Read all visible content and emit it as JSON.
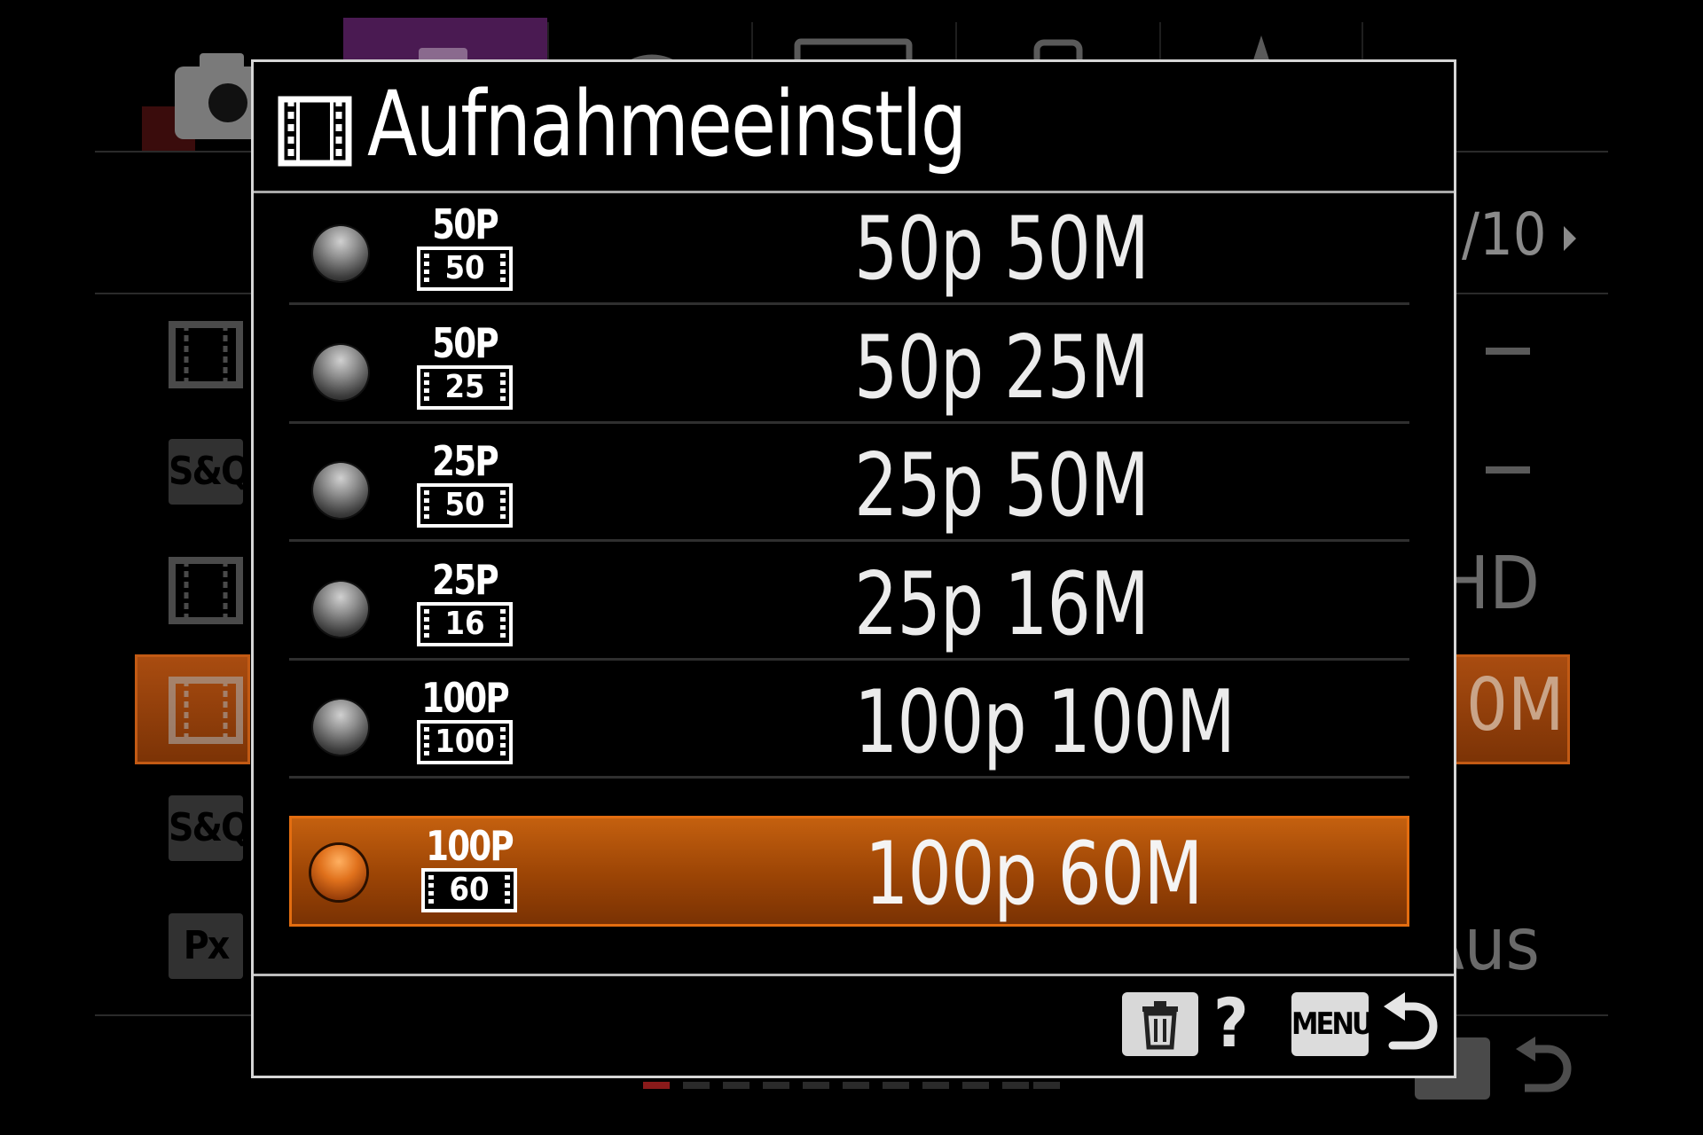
{
  "background": {
    "tabs": [
      {
        "name": "camera-tab",
        "active": false
      },
      {
        "name": "camera2-tab",
        "active": true
      },
      {
        "name": "network-tab",
        "active": false
      },
      {
        "name": "playback-tab",
        "active": false
      },
      {
        "name": "setup-tab",
        "active": false
      },
      {
        "name": "mymenu-tab",
        "active": false
      }
    ],
    "page_indicator": "/10",
    "side_chips": [
      "S&Q",
      "S&Q",
      "Px"
    ],
    "right_values": [
      "HD",
      "0M",
      "Aus"
    ],
    "menu_label": "MENU"
  },
  "dialog": {
    "title": "Aufnahmeeinstlg",
    "title_icon": "movie-icon",
    "options": [
      {
        "label": "50p 50M",
        "icon_top": "50P",
        "icon_bottom": "50",
        "selected": false
      },
      {
        "label": "50p 25M",
        "icon_top": "50P",
        "icon_bottom": "25",
        "selected": false
      },
      {
        "label": "25p 50M",
        "icon_top": "25P",
        "icon_bottom": "50",
        "selected": false
      },
      {
        "label": "25p 16M",
        "icon_top": "25P",
        "icon_bottom": "16",
        "selected": false
      },
      {
        "label": "100p 100M",
        "icon_top": "100P",
        "icon_bottom": "100",
        "selected": false
      },
      {
        "label": "100p 60M",
        "icon_top": "100P",
        "icon_bottom": "60",
        "selected": true
      }
    ],
    "footer": {
      "delete_icon": "trash-icon",
      "help_label": "?",
      "menu_label": "MENU",
      "back_icon": "return-arrow-icon"
    }
  },
  "colors": {
    "selection": "#9b4405",
    "selection_border": "#e36d10",
    "active_tab": "#5a1f63",
    "text": "#ffffff"
  }
}
